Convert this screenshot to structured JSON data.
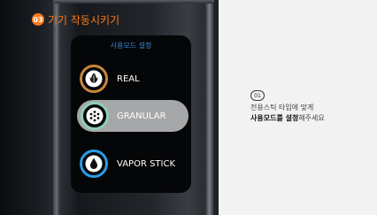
{
  "section": {
    "number": "03",
    "title": "기기 작동시키기"
  },
  "screen": {
    "header": "사용모드 설정",
    "modes": [
      {
        "label": "REAL",
        "icon": "leaf-icon",
        "ring_color": "#c9853a",
        "selected": false
      },
      {
        "label": "GRANULAR",
        "icon": "granules-icon",
        "ring_color": "#8fd0b0",
        "selected": true
      },
      {
        "label": "VAPOR STICK",
        "icon": "droplet-icon",
        "ring_color": "#2b9be8",
        "selected": false
      }
    ]
  },
  "instruction": {
    "step": "01",
    "line1": "전용스틱 타입에 맞게",
    "line2_bold": "사용모드를 설정",
    "line2_rest": "해주세요"
  },
  "colors": {
    "accent": "#ff7a1a",
    "screen_header": "#3e8ae0",
    "selected_bg": "#a6a7a9"
  }
}
